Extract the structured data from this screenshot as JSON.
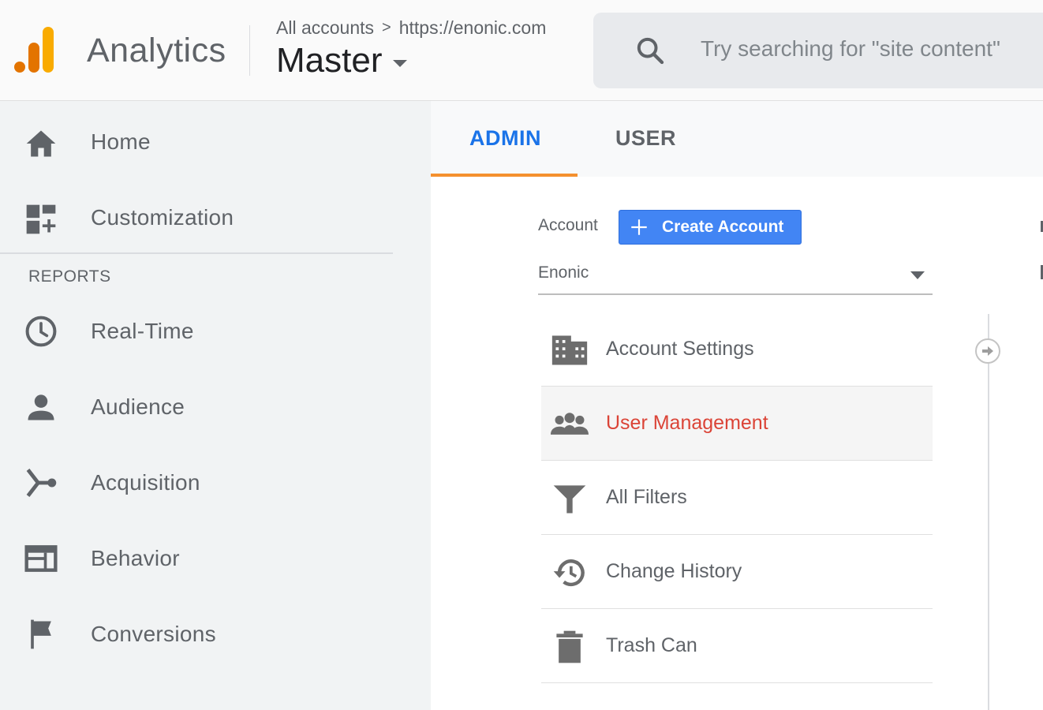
{
  "header": {
    "app_title": "Analytics",
    "breadcrumb": {
      "all_accounts": "All accounts",
      "separator": ">",
      "property": "https://enonic.com"
    },
    "view_name": "Master",
    "search": {
      "placeholder": "Try searching for \"site content\""
    }
  },
  "sidebar": {
    "top_items": [
      {
        "label": "Home",
        "icon": "home-icon"
      },
      {
        "label": "Customization",
        "icon": "dashboard-add-icon"
      }
    ],
    "reports_heading": "REPORTS",
    "report_items": [
      {
        "label": "Real-Time",
        "icon": "clock-icon"
      },
      {
        "label": "Audience",
        "icon": "person-icon"
      },
      {
        "label": "Acquisition",
        "icon": "merge-icon"
      },
      {
        "label": "Behavior",
        "icon": "web-layout-icon"
      },
      {
        "label": "Conversions",
        "icon": "flag-icon"
      }
    ]
  },
  "tabs": [
    {
      "label": "ADMIN",
      "active": true
    },
    {
      "label": "USER",
      "active": false
    }
  ],
  "admin": {
    "account_label": "Account",
    "create_button": "Create Account",
    "account_selected": "Enonic",
    "items": [
      {
        "label": "Account Settings",
        "icon": "building-icon",
        "active": false
      },
      {
        "label": "User Management",
        "icon": "group-icon",
        "active": true
      },
      {
        "label": "All Filters",
        "icon": "filter-icon",
        "active": false
      },
      {
        "label": "Change History",
        "icon": "history-icon",
        "active": false
      },
      {
        "label": "Trash Can",
        "icon": "trash-icon",
        "active": false
      }
    ]
  },
  "colors": {
    "accent_blue": "#1a73e8",
    "tab_underline": "#f4902e",
    "active_item": "#db4437",
    "button_blue": "#4285f4",
    "logo_orange": "#f9ab00",
    "logo_dark_orange": "#e37400"
  }
}
